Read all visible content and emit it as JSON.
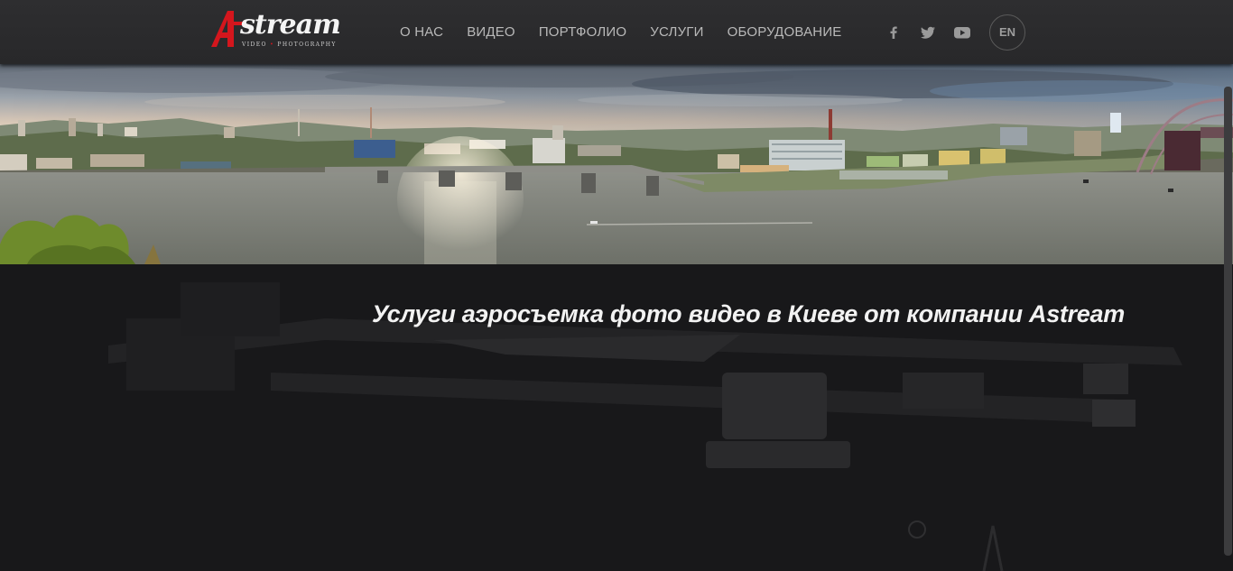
{
  "header": {
    "logo": {
      "word": "stream",
      "tagline_left": "VIDEO",
      "tagline_dot": "•",
      "tagline_right": "PHOTOGRAPHY",
      "brand_red": "#d4161d"
    },
    "nav": [
      {
        "label": "О НАС"
      },
      {
        "label": "ВИДЕО"
      },
      {
        "label": "ПОРТФОЛИО"
      },
      {
        "label": "УСЛУГИ"
      },
      {
        "label": "ОБОРУДОВАНИЕ"
      }
    ],
    "social": [
      {
        "icon": "facebook-icon"
      },
      {
        "icon": "twitter-icon"
      },
      {
        "icon": "youtube-icon"
      }
    ],
    "language": "EN"
  },
  "banner": {
    "image": "panorama-of-kyiv-river-icon"
  },
  "main": {
    "headline": "Услуги аэросъемка фото видео в Киеве от компании Astream"
  },
  "colors": {
    "header_bg": "#2c2c2e",
    "nav_text": "#b9b9b9",
    "page_bg": "#18181a",
    "headline": "#f2f2f2"
  }
}
